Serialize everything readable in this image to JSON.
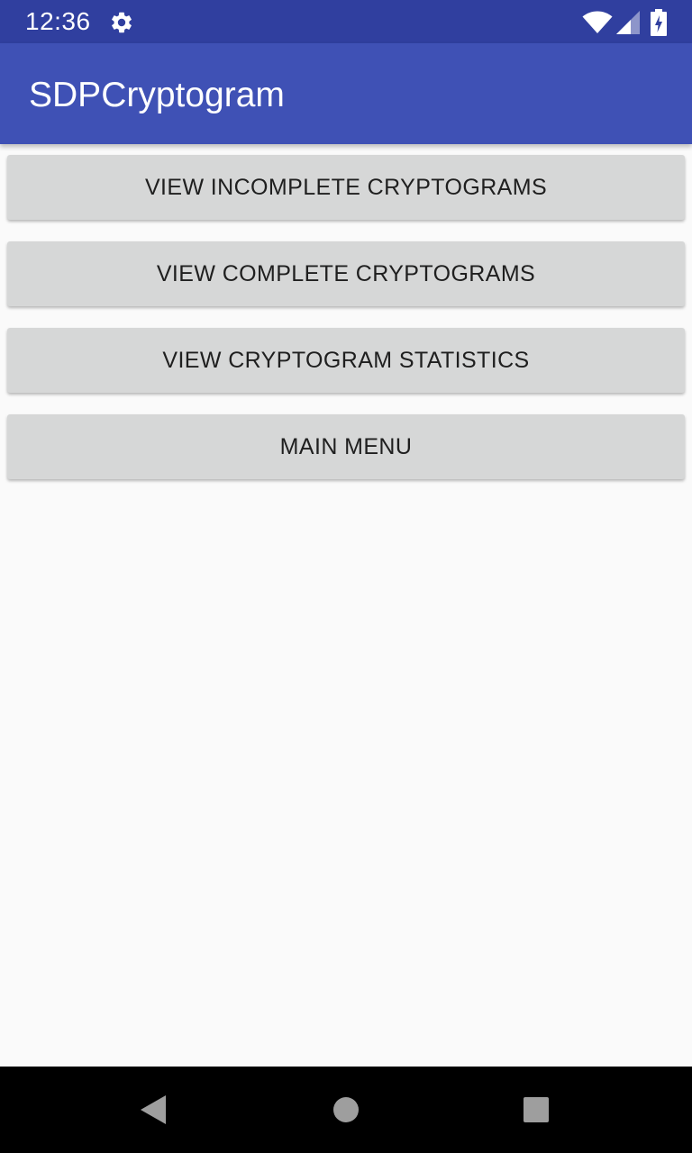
{
  "status_bar": {
    "time": "12:36",
    "icons": [
      "gear-icon",
      "wifi-icon",
      "cellular-signal-icon",
      "battery-charging-icon"
    ]
  },
  "app_bar": {
    "title": "SDPCryptogram",
    "color": "#3f51b5"
  },
  "main": {
    "buttons": [
      {
        "label": "VIEW INCOMPLETE CRYPTOGRAMS"
      },
      {
        "label": "VIEW COMPLETE CRYPTOGRAMS"
      },
      {
        "label": "VIEW CRYPTOGRAM STATISTICS"
      },
      {
        "label": "MAIN MENU"
      }
    ]
  },
  "nav_bar": {
    "icons": [
      "back-icon",
      "home-icon",
      "recents-icon"
    ]
  },
  "colors": {
    "status_bar": "#303f9f",
    "app_bar": "#3f51b5",
    "button": "#d6d7d7",
    "background": "#fafafa"
  }
}
